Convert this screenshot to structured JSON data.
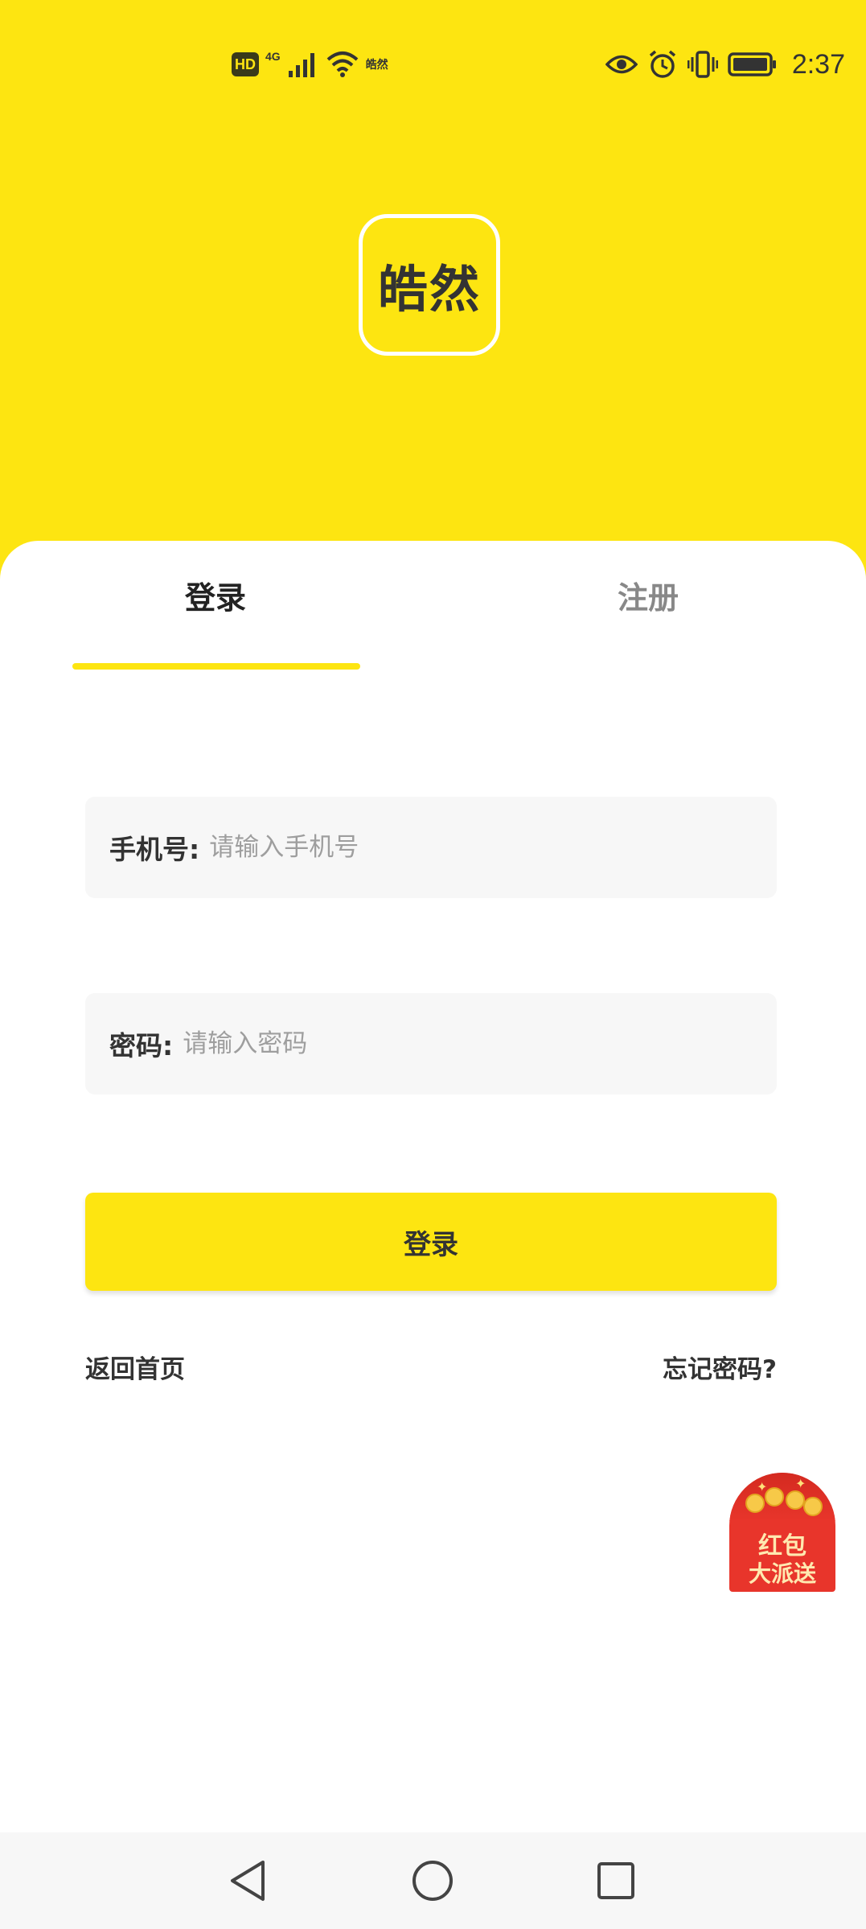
{
  "status_bar": {
    "hd": "HD",
    "network": "4G",
    "app_name": "皓然",
    "time": "2:37"
  },
  "logo": {
    "text": "皓然"
  },
  "tabs": [
    {
      "label": "登录",
      "active": true
    },
    {
      "label": "注册",
      "active": false
    }
  ],
  "form": {
    "phone_label": "手机号:",
    "phone_placeholder": "请输入手机号",
    "phone_value": "",
    "password_label": "密码:",
    "password_placeholder": "请输入密码",
    "password_value": ""
  },
  "login_button": "登录",
  "links": {
    "back_home": "返回首页",
    "forgot_password": "忘记密码?"
  },
  "red_packet": {
    "line1": "红包",
    "line2": "大派送"
  },
  "colors": {
    "brand": "#fde511",
    "text": "#333333",
    "muted": "#888888",
    "field_bg": "#f7f7f7",
    "red_packet": "#e8352b"
  },
  "icons": [
    "eye-icon",
    "alarm-icon",
    "vibrate-icon",
    "battery-icon",
    "wifi-icon",
    "signal-icon",
    "nav-back-icon",
    "nav-home-icon",
    "nav-recent-icon"
  ]
}
